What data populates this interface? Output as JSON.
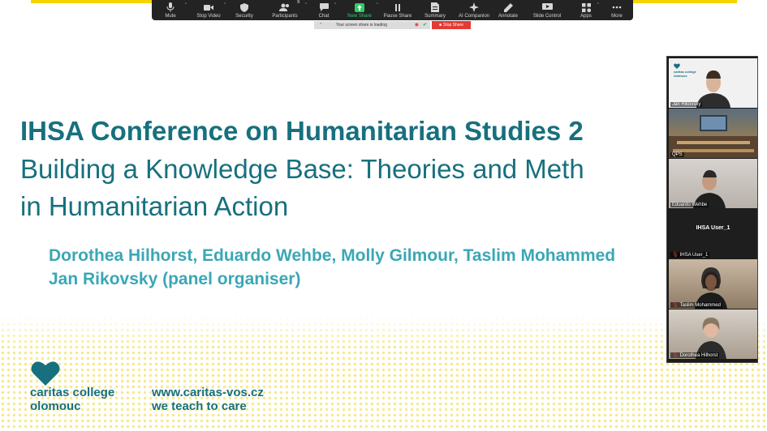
{
  "toolbar": {
    "items": [
      {
        "label": "Mute",
        "icon": "microphone-icon"
      },
      {
        "label": "Stop Video",
        "icon": "video-camera-icon"
      },
      {
        "label": "Security",
        "icon": "shield-icon"
      },
      {
        "label": "Participants",
        "icon": "participants-icon",
        "count": "9"
      },
      {
        "label": "Chat",
        "icon": "chat-icon"
      },
      {
        "label": "New Share",
        "icon": "share-screen-icon"
      },
      {
        "label": "Pause Share",
        "icon": "pause-icon"
      },
      {
        "label": "Summary",
        "icon": "summary-icon"
      },
      {
        "label": "AI Companion",
        "icon": "ai-sparkle-icon"
      },
      {
        "label": "Annotate",
        "icon": "pen-icon"
      },
      {
        "label": "Slide Control",
        "icon": "slide-control-icon"
      },
      {
        "label": "Apps",
        "icon": "apps-icon"
      },
      {
        "label": "More",
        "icon": "more-dots-icon"
      }
    ]
  },
  "share_bar": {
    "status": "Your screen share is loading",
    "stop_label": "Stop Share"
  },
  "slide": {
    "title": "IHSA Conference on Humanitarian Studies 2",
    "subtitle_line1": "Building a Knowledge Base: Theories and Meth",
    "subtitle_line2": "in Humanitarian Action",
    "authors_line1": "Dorothea Hilhorst, Eduardo Wehbe, Molly Gilmour, Taslim Mohammed",
    "authors_line2": "Jan Rikovsky (panel organiser)",
    "logo_line1": "caritas college",
    "logo_line2": "olomouc",
    "web_line1": "www.caritas-vos.cz",
    "web_line2": "we teach to care"
  },
  "gallery": {
    "mini_logo": [
      "caritas college",
      "olomouc"
    ],
    "participants": [
      {
        "name": "Jan Rikovsky",
        "muted": false
      },
      {
        "name": "QPS",
        "muted": false
      },
      {
        "name": "Eduardo Wehbe",
        "muted": false
      },
      {
        "name": "IHSA User_1",
        "muted": true
      },
      {
        "name": "Taslim Mohammed",
        "muted": true
      },
      {
        "name": "Dorothea Hilhorst",
        "muted": true
      }
    ]
  },
  "colors": {
    "brand_teal": "#17707e",
    "author_teal": "#3aa7b6",
    "accent_yellow": "#f5d400",
    "stop_red": "#e23b34",
    "share_green": "#35c86a"
  }
}
